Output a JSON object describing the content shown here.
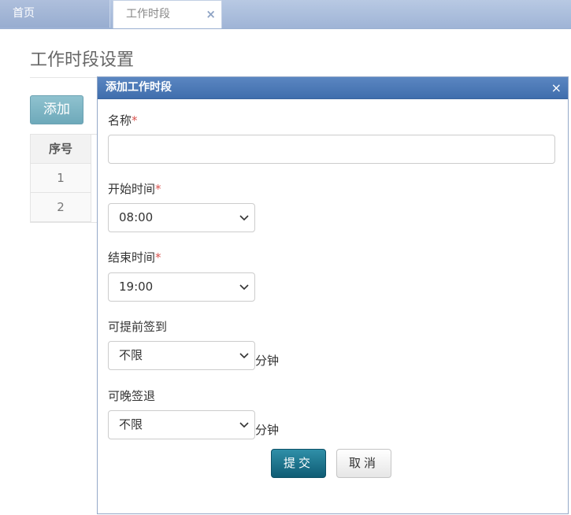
{
  "tabs": {
    "home_label": "首页",
    "active_label": "工作时段",
    "close_glyph": "×"
  },
  "page": {
    "title": "工作时段设置",
    "add_label": "添加",
    "table": {
      "header_index": "序号",
      "rows": [
        "1",
        "2"
      ]
    },
    "edge_mark": "⋮"
  },
  "dialog": {
    "title": "添加工作时段",
    "close_glyph": "×",
    "name": {
      "label": "名称",
      "required": "*",
      "value": ""
    },
    "start": {
      "label": "开始时间",
      "required": "*",
      "value": "08:00"
    },
    "end": {
      "label": "结束时间",
      "required": "*",
      "value": "19:00"
    },
    "early": {
      "label": "可提前签到",
      "value": "不限",
      "unit": "分钟"
    },
    "late": {
      "label": "可晚签退",
      "value": "不限",
      "unit": "分钟"
    },
    "submit_label": "提交",
    "cancel_label": "取消"
  },
  "colors": {
    "header": "#4a78b5",
    "submit": "#1a6e88",
    "add": "#7fb6c6",
    "required": "#d9534f"
  }
}
